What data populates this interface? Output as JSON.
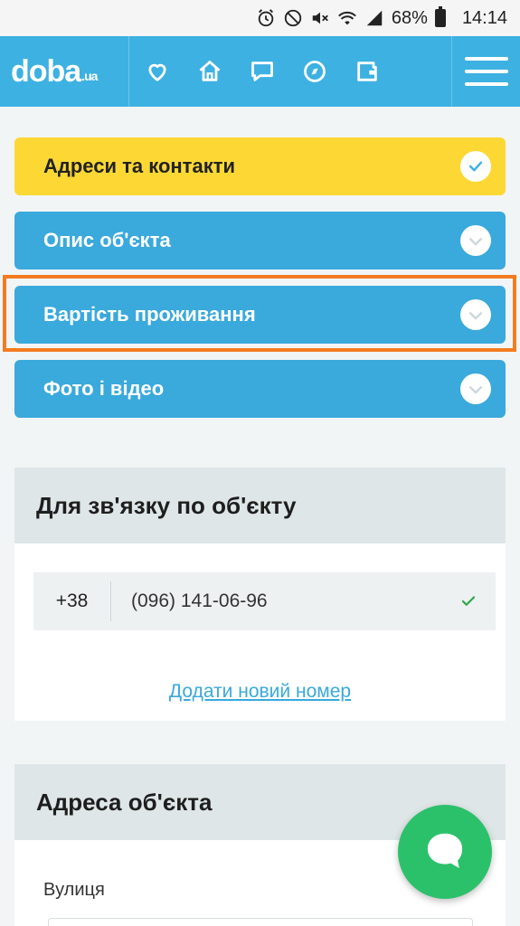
{
  "status_bar": {
    "battery": "68%",
    "time": "14:14",
    "icons": [
      "alarm-icon",
      "do-not-disturb-icon",
      "mute-icon",
      "wifi-icon",
      "signal-icon",
      "battery-icon"
    ]
  },
  "header": {
    "logo_main": "doba",
    "logo_suffix": ".ua",
    "nav_icons": [
      "heart-icon",
      "home-icon",
      "chat-icon",
      "compass-icon",
      "wallet-icon",
      "hamburger-menu-icon"
    ],
    "accent_color": "#3db1e2"
  },
  "tabs": [
    {
      "label": "Адреси та контакти",
      "active": true
    },
    {
      "label": "Опис об'єкта",
      "active": false
    },
    {
      "label": "Вартість проживання",
      "active": false,
      "highlighted": true
    },
    {
      "label": "Фото і відео",
      "active": false
    }
  ],
  "contact_card": {
    "title": "Для зв'язку по об'єкту",
    "phone_code": "+38",
    "phone_number": "(096) 141-06-96",
    "add_link": "Додати новий номер"
  },
  "address_card": {
    "title": "Адреса об'єкта",
    "street_label": "Вулиця"
  },
  "colors": {
    "active_tab": "#fdd835",
    "tab": "#3aa9dc",
    "highlight": "#f37c20",
    "fab": "#2bc16b"
  },
  "fab": {
    "icon": "chat-bubble-icon"
  }
}
